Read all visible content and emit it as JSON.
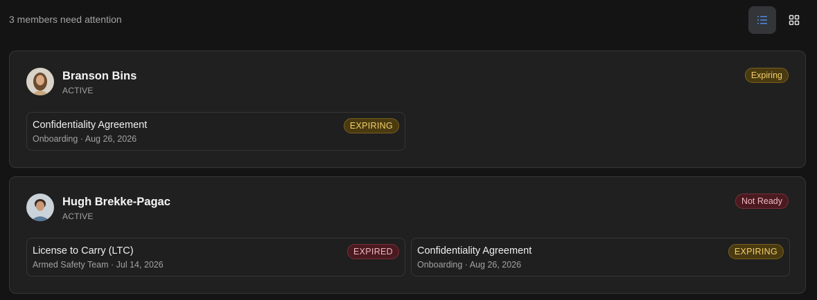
{
  "header": {
    "summary": "3 members need attention",
    "view_options": [
      {
        "icon": "list-icon",
        "active": true
      },
      {
        "icon": "grid-icon",
        "active": false
      }
    ]
  },
  "members": [
    {
      "name": "Branson Bins",
      "status": "ACTIVE",
      "badge": "Expiring",
      "badge_type": "expiring",
      "documents": [
        {
          "title": "Confidentiality Agreement",
          "subtitle": "Onboarding · Aug 26, 2026",
          "badge": "EXPIRING",
          "badge_type": "expiring"
        }
      ]
    },
    {
      "name": "Hugh Brekke-Pagac",
      "status": "ACTIVE",
      "badge": "Not Ready",
      "badge_type": "notready",
      "documents": [
        {
          "title": "License to Carry (LTC)",
          "subtitle": "Armed Safety Team · Jul 14, 2026",
          "badge": "EXPIRED",
          "badge_type": "expired"
        },
        {
          "title": "Confidentiality Agreement",
          "subtitle": "Onboarding · Aug 26, 2026",
          "badge": "EXPIRING",
          "badge_type": "expiring"
        }
      ]
    }
  ]
}
